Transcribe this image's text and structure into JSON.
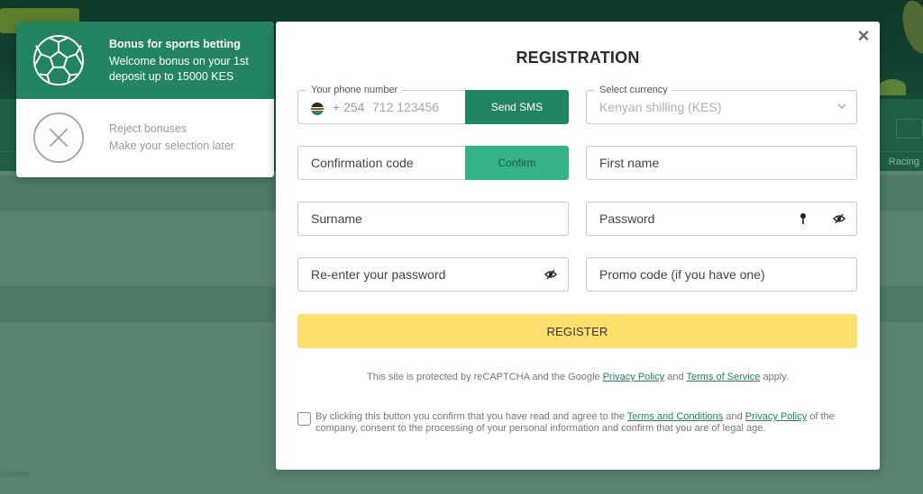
{
  "background": {
    "nav_right_text": "Racing",
    "footer_text": "Games"
  },
  "bonus": {
    "options": [
      {
        "title": "Bonus for sports betting",
        "description": "Welcome bonus on your 1st deposit up to 15000 KES",
        "icon": "soccer-ball-icon",
        "selected": true
      },
      {
        "title": "Reject bonuses",
        "description": "Make your selection later",
        "icon": "close-circle-icon",
        "selected": false
      }
    ]
  },
  "modal": {
    "title": "REGISTRATION",
    "close_icon": "×",
    "phone": {
      "legend": "Your phone number",
      "country_code": "+ 254",
      "placeholder": "712 123456",
      "send_button": "Send SMS"
    },
    "currency": {
      "legend": "Select currency",
      "value": "Kenyan shilling (KES)"
    },
    "confirmation": {
      "placeholder": "Confirmation code",
      "confirm_button": "Confirm"
    },
    "first_name": {
      "placeholder": "First name"
    },
    "surname": {
      "placeholder": "Surname"
    },
    "password": {
      "placeholder": "Password"
    },
    "reenter_password": {
      "placeholder": "Re-enter your password"
    },
    "promo_code": {
      "placeholder": "Promo code (if you have one)"
    },
    "register_button": "REGISTER",
    "recaptcha": {
      "prefix": "This site is protected by reCAPTCHA and the Google",
      "privacy_link": "Privacy Policy",
      "and": "and",
      "terms_link": "Terms of Service",
      "suffix": "apply."
    },
    "consent": {
      "checked": false,
      "prefix": "By clicking this button you confirm that you have read and agree to the",
      "terms_link": "Terms and Conditions",
      "and": "and",
      "privacy_link": "Privacy Policy",
      "suffix": "of the company, consent to the processing of your personal information and confirm that you are of legal age."
    }
  },
  "colors": {
    "brand_green": "#238461",
    "confirm_green": "#34b386",
    "register_yellow": "#ffdf6e",
    "link_green": "#238461"
  }
}
